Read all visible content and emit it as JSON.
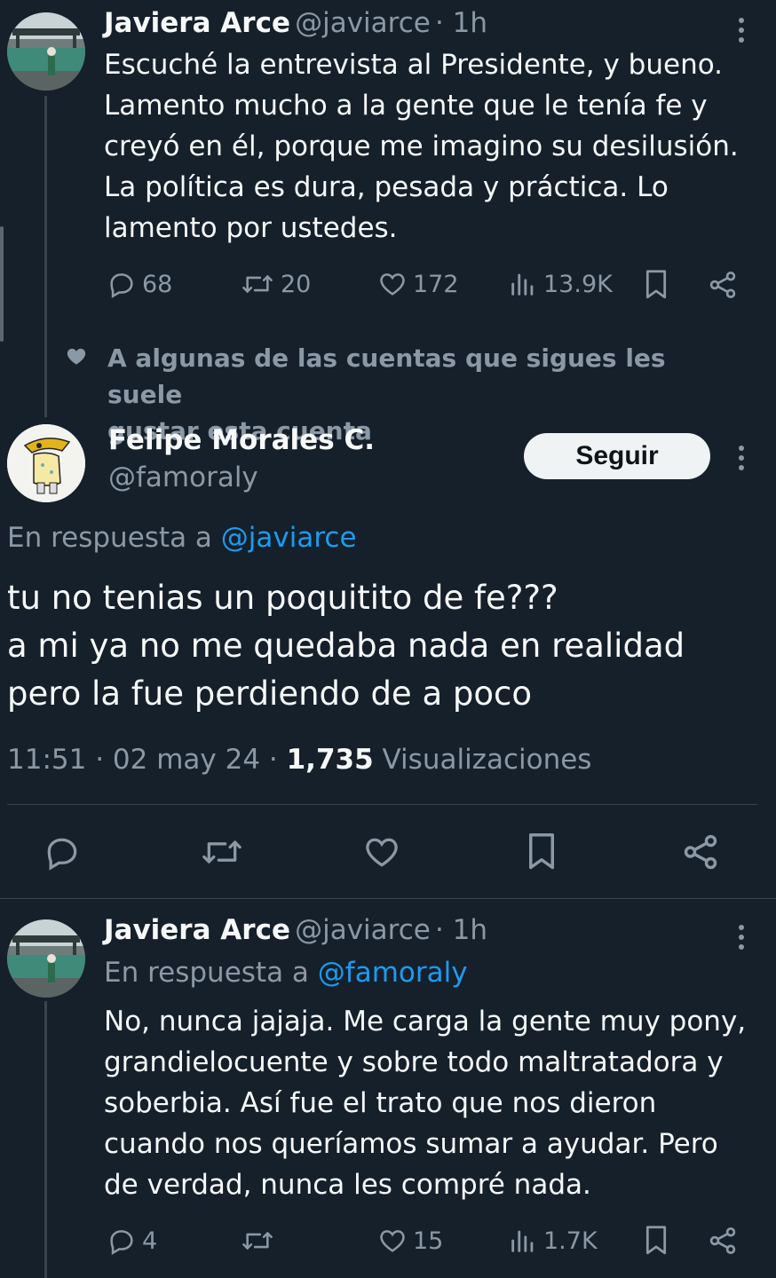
{
  "tweet1": {
    "name": "Javiera Arce",
    "handle": "@javiarce",
    "time": "· 1h",
    "text": "Escuché la entrevista al Presidente, y bueno.\nLamento mucho a la gente que le tenía fe y\ncreyó en él, porque me imagino su desilusión.\nLa política es dura, pesada y práctica. Lo\nlamento por ustedes.",
    "replies": "68",
    "retweets": "20",
    "likes": "172",
    "views": "13.9K"
  },
  "social_context": {
    "text": "A algunas de las cuentas que sigues les suele\ngustar esta cuenta",
    "icon": "heart-icon"
  },
  "main_tweet": {
    "name": "Felipe Morales C.",
    "handle": "@famoraly",
    "follow_label": "Seguir",
    "reply_prefix": "En respuesta a ",
    "reply_to": "@javiarce",
    "text": "tu no tenias un poquitito de fe???\na mi ya no me quedaba nada en realidad\npero la fue perdiendo de a poco",
    "timestamp": "11:51 · 02 may 24 · ",
    "view_count": "1,735",
    "view_label": " Visualizaciones"
  },
  "tweet3": {
    "name": "Javiera Arce",
    "handle": "@javiarce",
    "time": "· 1h",
    "reply_prefix": "En respuesta a ",
    "reply_to": "@famoraly",
    "text": "No, nunca jajaja. Me carga la gente muy pony,\ngrandielocuente y sobre todo maltratadora y\nsoberbia. Así fue el trato que nos dieron\ncuando nos queríamos sumar a ayudar. Pero\nde verdad, nunca les compré nada.",
    "replies": "4",
    "retweets": "",
    "likes": "15",
    "views": "1.7K"
  },
  "colors": {
    "background": "#15202b",
    "text": "#f7f9f9",
    "muted": "#8b98a5",
    "link": "#1d9bf0",
    "divider": "#38444d"
  }
}
